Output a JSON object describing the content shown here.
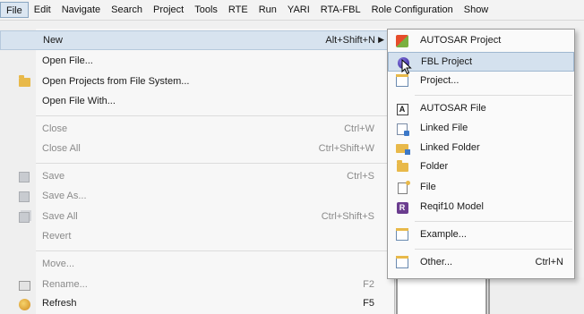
{
  "menubar": {
    "items": [
      {
        "label": "File",
        "active": true
      },
      {
        "label": "Edit"
      },
      {
        "label": "Navigate"
      },
      {
        "label": "Search"
      },
      {
        "label": "Project"
      },
      {
        "label": "Tools"
      },
      {
        "label": "RTE"
      },
      {
        "label": "Run"
      },
      {
        "label": "YARI"
      },
      {
        "label": "RTA-FBL"
      },
      {
        "label": "Role Configuration"
      },
      {
        "label": "Show"
      }
    ]
  },
  "file_menu": {
    "items": [
      {
        "label": "New",
        "shortcut": "Alt+Shift+N",
        "has_submenu": true,
        "highlight": true,
        "icon": "none"
      },
      {
        "label": "Open File...",
        "icon": "none"
      },
      {
        "label": "Open Projects from File System...",
        "icon": "open-folder-icon"
      },
      {
        "label": "Open File With...",
        "icon": "none"
      },
      {
        "label": "Close",
        "shortcut": "Ctrl+W",
        "disabled": true
      },
      {
        "label": "Close All",
        "shortcut": "Ctrl+Shift+W",
        "disabled": true
      },
      {
        "label": "Save",
        "shortcut": "Ctrl+S",
        "disabled": true,
        "icon": "save-icon"
      },
      {
        "label": "Save As...",
        "disabled": true,
        "icon": "save-as-icon"
      },
      {
        "label": "Save All",
        "shortcut": "Ctrl+Shift+S",
        "disabled": true,
        "icon": "save-all-icon"
      },
      {
        "label": "Revert",
        "disabled": true
      },
      {
        "label": "Move...",
        "disabled": true
      },
      {
        "label": "Rename...",
        "shortcut": "F2",
        "disabled": true,
        "icon": "rename-icon"
      },
      {
        "label": "Refresh",
        "shortcut": "F5",
        "icon": "refresh-icon"
      }
    ]
  },
  "new_submenu": {
    "items": [
      {
        "label": "AUTOSAR Project",
        "icon": "autosar-project-icon"
      },
      {
        "label": "FBL Project",
        "icon": "fbl-project-icon",
        "highlight": true
      },
      {
        "label": "Project...",
        "icon": "project-icon"
      },
      {
        "label": "AUTOSAR File",
        "icon": "autosar-file-icon"
      },
      {
        "label": "Linked File",
        "icon": "linked-file-icon"
      },
      {
        "label": "Linked Folder",
        "icon": "linked-folder-icon"
      },
      {
        "label": "Folder",
        "icon": "folder-icon"
      },
      {
        "label": "File",
        "icon": "file-icon"
      },
      {
        "label": "Reqif10 Model",
        "icon": "reqif-model-icon"
      },
      {
        "label": "Example...",
        "icon": "example-icon"
      },
      {
        "label": "Other...",
        "shortcut": "Ctrl+N",
        "icon": "other-icon"
      }
    ],
    "autosar_file_glyph": "A",
    "reqif_glyph": "R"
  }
}
